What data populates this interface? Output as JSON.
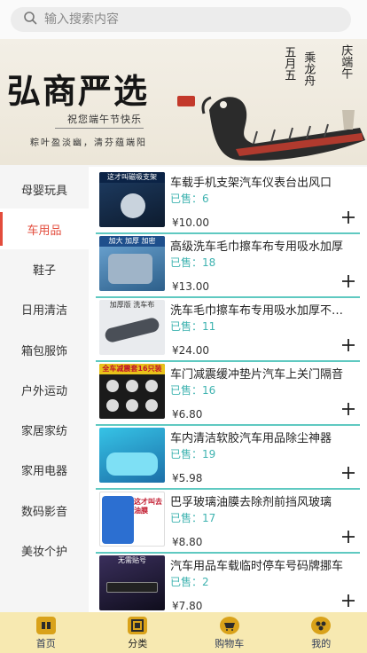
{
  "search": {
    "placeholder": "输入搜索内容"
  },
  "banner": {
    "title": "弘商严选",
    "subtitle": "祝您端午节快乐",
    "tagline": "粽叶盈淡幽，清芬蕴端阳",
    "vertical_1": "五月五",
    "vertical_2": "乘龙舟",
    "vertical_3": "庆端午"
  },
  "sidebar": {
    "items": [
      {
        "label": "母婴玩具"
      },
      {
        "label": "车用品",
        "active": true
      },
      {
        "label": "鞋子"
      },
      {
        "label": "日用清洁"
      },
      {
        "label": "箱包服饰"
      },
      {
        "label": "户外运动"
      },
      {
        "label": "家居家纺"
      },
      {
        "label": "家用电器"
      },
      {
        "label": "数码影音"
      },
      {
        "label": "美妆个护"
      }
    ]
  },
  "products": [
    {
      "name": "车载手机支架汽车仪表台出风口",
      "sold": "已售：6",
      "price": "¥10.00",
      "img_text": "这才叫磁吸支架"
    },
    {
      "name": "高级洗车毛巾擦车布专用吸水加厚",
      "sold": "已售：18",
      "price": "¥13.00",
      "img_text": "加大 加厚 加密"
    },
    {
      "name": "洗车毛巾擦车布专用吸水加厚不掉毛",
      "sold": "已售：11",
      "price": "¥24.00",
      "img_text": "加厚版 洗车布"
    },
    {
      "name": "车门减震缓冲垫片汽车上关门隔音",
      "sold": "已售：16",
      "price": "¥6.80",
      "img_text": "全车减震套16只装"
    },
    {
      "name": "车内清洁软胶汽车用品除尘神器",
      "sold": "已售：19",
      "price": "¥5.98",
      "img_text": ""
    },
    {
      "name": "巴孚玻璃油膜去除剂前挡风玻璃",
      "sold": "已售：17",
      "price": "¥8.80",
      "img_text": "这才叫去油膜"
    },
    {
      "name": "汽车用品车载临时停车号码牌挪车",
      "sold": "已售：2",
      "price": "¥7.80",
      "img_text": "无需贴号"
    }
  ],
  "tabbar": {
    "items": [
      {
        "label": "首页",
        "icon": "home-icon"
      },
      {
        "label": "分类",
        "icon": "category-icon",
        "active": true
      },
      {
        "label": "购物车",
        "icon": "cart-icon"
      },
      {
        "label": "我的",
        "icon": "profile-icon"
      }
    ]
  },
  "colors": {
    "accent": "#e34c3c",
    "sold": "#3fb3b0",
    "divider": "#5fc9c1",
    "tabbar_bg": "#f7e9b1",
    "tab_icon": "#d9a21a"
  }
}
